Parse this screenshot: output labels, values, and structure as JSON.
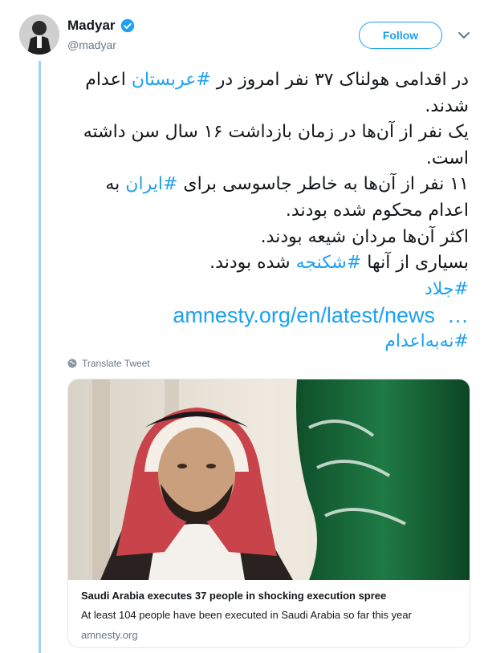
{
  "author": {
    "name": "Madyar",
    "handle": "@madyar",
    "verified": true
  },
  "follow_label": "Follow",
  "tweet": {
    "lines": [
      [
        "در اقدامی هولناک ۳۷ نفر امروز در ",
        "#عربستان",
        " اعدام"
      ],
      [
        "شدند."
      ],
      [
        "یک نفر از آن‌ها در زمان بازداشت ۱۶ سال سن داشته"
      ],
      [
        "است."
      ],
      [
        "۱۱ نفر از آن‌ها به خاطر جاسوسی برای ",
        "#ایران",
        " به"
      ],
      [
        "اعدام محکوم شده بودند."
      ],
      [
        "اکثر آن‌ها مردان شیعه بودند."
      ],
      [
        "بسیاری از آنها ",
        "#شکنجه",
        " شده بودند."
      ]
    ],
    "hashtag_jallad": "#جلاد",
    "link": "amnesty.org/en/latest/news",
    "ellipsis": "…",
    "hashtag_final": "#نه‌به‌اعدام"
  },
  "translate_label": "Translate Tweet",
  "card": {
    "title": "Saudi Arabia executes 37 people in shocking execution spree",
    "description": "At least 104 people have been executed in Saudi Arabia so far this year",
    "domain": "amnesty.org"
  },
  "colors": {
    "accent": "#1da1f2",
    "text": "#14171a",
    "secondary": "#657786",
    "thread_line": "#9fd4f7",
    "flag_green": "#1b6b3a"
  },
  "icons": [
    "verified-badge-icon",
    "chevron-down-icon",
    "globe-icon"
  ]
}
